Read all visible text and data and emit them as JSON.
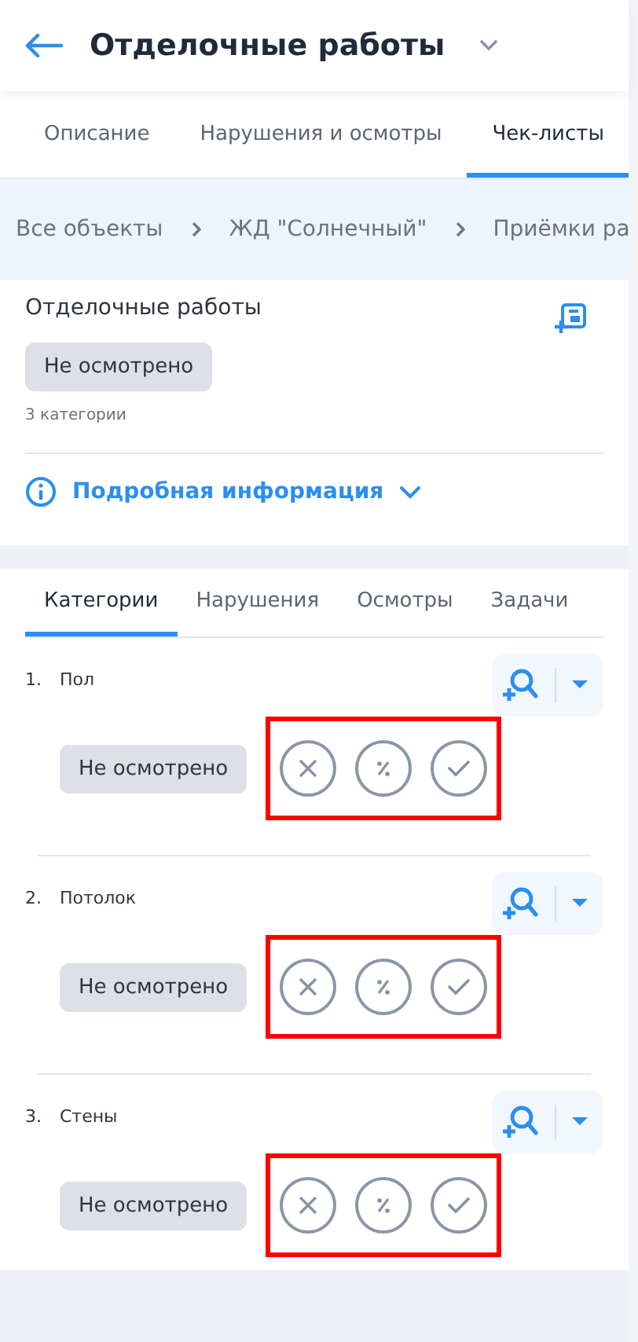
{
  "header": {
    "title": "Отделочные работы"
  },
  "tabs": [
    {
      "label": "Описание",
      "selected": false
    },
    {
      "label": "Нарушения и осмотры",
      "selected": false
    },
    {
      "label": "Чек-листы",
      "selected": true
    }
  ],
  "breadcrumbs": [
    "Все объекты",
    "ЖД \"Солнечный\"",
    "Приёмки ра"
  ],
  "summary": {
    "title": "Отделочные работы",
    "status": "Не осмотрено",
    "count": "3 категории",
    "details_link": "Подробная информация",
    "details_expanded": false
  },
  "subtabs": [
    {
      "label": "Категории",
      "selected": true
    },
    {
      "label": "Нарушения",
      "selected": false
    },
    {
      "label": "Осмотры",
      "selected": false
    },
    {
      "label": "Задачи",
      "selected": false
    }
  ],
  "categories": [
    {
      "number": "1.",
      "name": "Пол",
      "status": "Не осмотрено",
      "highlighted": true
    },
    {
      "number": "2.",
      "name": "Потолок",
      "status": "Не осмотрено",
      "highlighted": true
    },
    {
      "number": "3.",
      "name": "Стены",
      "status": "Не осмотрено",
      "highlighted": true
    }
  ]
}
